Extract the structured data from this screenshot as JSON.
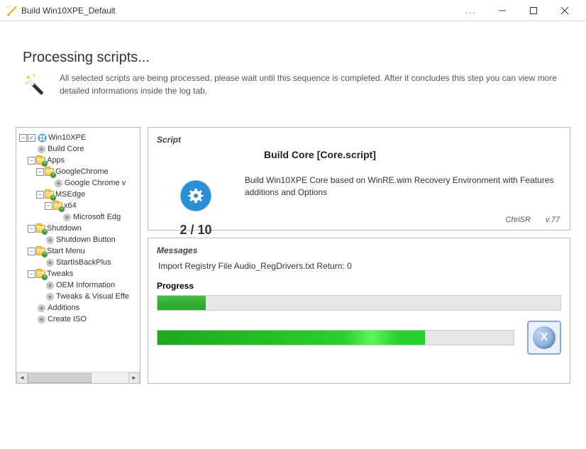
{
  "window": {
    "title": "Build Win10XPE_Default"
  },
  "header": {
    "heading": "Processing scripts...",
    "description": "All selected scripts are being processed, please wait until this sequence is completed. After it concludes this step you can view more detailed informations inside the log tab."
  },
  "tree": {
    "items": [
      {
        "indent": 0,
        "tw": "−",
        "check": true,
        "icon": "win-logo",
        "label": "Win10XPE"
      },
      {
        "indent": 1,
        "tw": "",
        "icon": "gear",
        "label": "Build Core"
      },
      {
        "indent": 1,
        "tw": "−",
        "icon": "folder-plus",
        "label": "Apps"
      },
      {
        "indent": 2,
        "tw": "−",
        "icon": "folder-plus",
        "label": "GoogleChrome"
      },
      {
        "indent": 3,
        "tw": "",
        "icon": "gear",
        "label": "Google Chrome v"
      },
      {
        "indent": 2,
        "tw": "−",
        "icon": "folder-plus",
        "label": "MSEdge"
      },
      {
        "indent": 3,
        "tw": "−",
        "icon": "folder-plus",
        "label": "x64"
      },
      {
        "indent": 4,
        "tw": "",
        "icon": "gear",
        "label": "Microsoft Edg"
      },
      {
        "indent": 1,
        "tw": "−",
        "icon": "folder-plus",
        "label": "Shutdown"
      },
      {
        "indent": 2,
        "tw": "",
        "icon": "gear",
        "label": "Shutdown Button"
      },
      {
        "indent": 1,
        "tw": "−",
        "icon": "folder-plus",
        "label": "Start Menu"
      },
      {
        "indent": 2,
        "tw": "",
        "icon": "gear",
        "label": "StartIsBackPlus"
      },
      {
        "indent": 1,
        "tw": "−",
        "icon": "folder-plus",
        "label": "Tweaks"
      },
      {
        "indent": 2,
        "tw": "",
        "icon": "gear",
        "label": "OEM Information"
      },
      {
        "indent": 2,
        "tw": "",
        "icon": "gear",
        "label": "Tweaks & Visual Effe"
      },
      {
        "indent": 1,
        "tw": "",
        "icon": "gear",
        "label": "Additions"
      },
      {
        "indent": 1,
        "tw": "",
        "icon": "gear",
        "label": "Create ISO"
      }
    ]
  },
  "script_panel": {
    "title": "Script",
    "name": "Build Core [Core.script]",
    "description": "Build Win10XPE Core based on WinRE.wim Recovery Environment with Features additions and Options",
    "counter": "2 / 10",
    "author": "ChriSR",
    "version": "v.77"
  },
  "messages_panel": {
    "title": "Messages",
    "log_line": "Import Registry File Audio_RegDrivers.txt Return: 0",
    "progress_label": "Progress",
    "progress1_pct": 12,
    "progress2_pct": 75,
    "cancel_glyph": "X"
  },
  "colors": {
    "progress_green": "#2bcf2b",
    "border_gray": "#bbbbbb"
  }
}
